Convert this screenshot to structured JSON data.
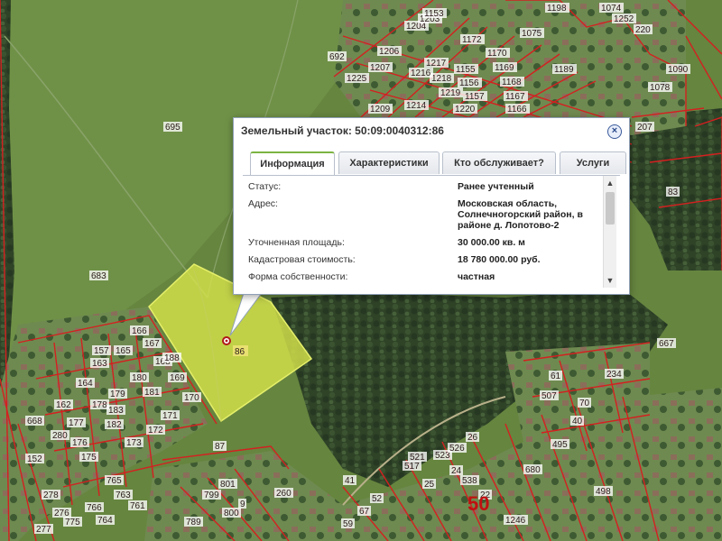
{
  "popup": {
    "title": "Земельный участок: 50:09:0040312:86",
    "close_label": "×",
    "tabs": [
      {
        "label": "Информация",
        "active": true
      },
      {
        "label": "Характеристики",
        "active": false
      },
      {
        "label": "Кто обслуживает?",
        "active": false
      },
      {
        "label": "Услуги",
        "active": false
      }
    ],
    "fields": [
      {
        "label": "Статус:",
        "value": "Ранее учтенный"
      },
      {
        "label": "Адрес:",
        "value": "Московская область, Солнечногорский район, в районе д. Лопотово-2"
      },
      {
        "label": "Уточненная площадь:",
        "value": "30 000.00 кв. м"
      },
      {
        "label": "Кадастровая стоимость:",
        "value": "18 780 000.00 руб."
      },
      {
        "label": "Форма собственности:",
        "value": "частная"
      }
    ],
    "scroll_up": "▲",
    "scroll_down": "▼"
  },
  "map": {
    "selected_parcel_label": "86",
    "big_label": "50",
    "parcel_labels": [
      "692",
      "695",
      "683",
      "1172",
      "1170",
      "1169",
      "1168",
      "1167",
      "1166",
      "1155",
      "1156",
      "1157",
      "1217",
      "1218",
      "1219",
      "1220",
      "1216",
      "1214",
      "1206",
      "1207",
      "1225",
      "1209",
      "1204",
      "1203",
      "1153",
      "1075",
      "1198",
      "1189",
      "1074",
      "1252",
      "220",
      "1090",
      "1078",
      "207",
      "83",
      "667",
      "234",
      "70",
      "61",
      "40",
      "495",
      "507",
      "680",
      "498",
      "521",
      "523",
      "526",
      "538",
      "26",
      "25",
      "24",
      "22",
      "517",
      "52",
      "67",
      "59",
      "1246",
      "260",
      "87",
      "166",
      "167",
      "168",
      "169",
      "170",
      "165",
      "163",
      "164",
      "179",
      "180",
      "181",
      "178",
      "177",
      "176",
      "175",
      "173",
      "172",
      "171",
      "182",
      "183",
      "162",
      "157",
      "188",
      "280",
      "152",
      "278",
      "276",
      "277",
      "775",
      "765",
      "764",
      "766",
      "761",
      "763",
      "801",
      "799",
      "800",
      "789",
      "9",
      "41",
      "668"
    ],
    "colors": {
      "parcel_boundary": "#d42020",
      "selected_fill": "#d4e24a",
      "forest": "#2b3d24",
      "field": "#66853f"
    }
  }
}
